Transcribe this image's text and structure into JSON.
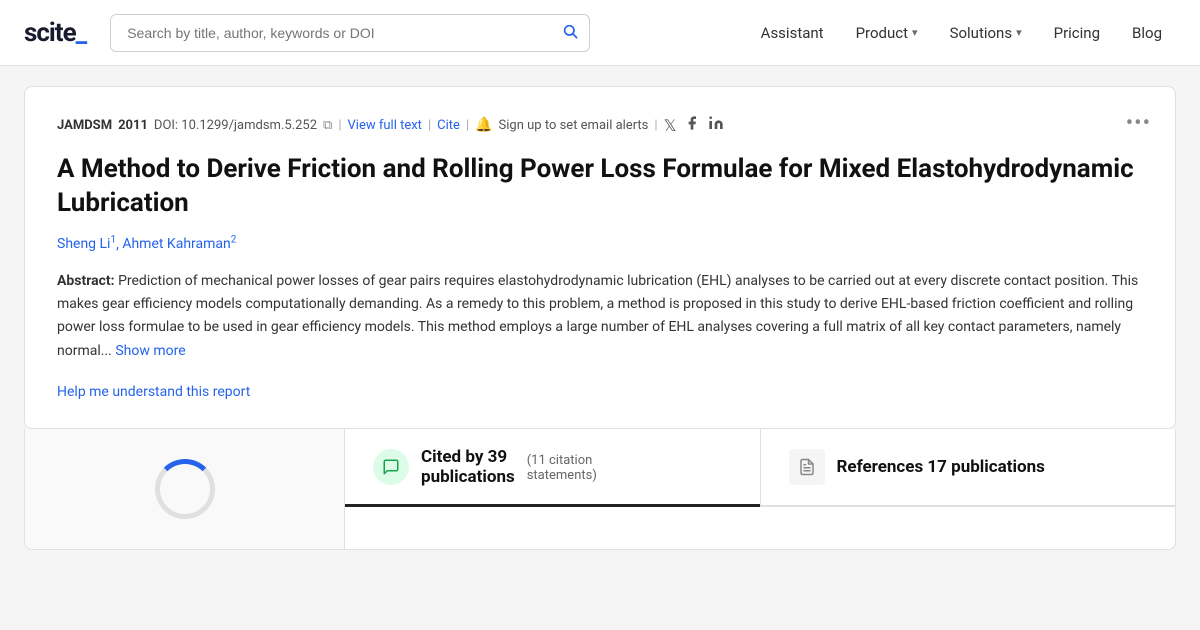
{
  "header": {
    "logo_text": "scite_",
    "search_placeholder": "Search by title, author, keywords or DOI",
    "nav": [
      {
        "label": "Assistant",
        "has_dropdown": false
      },
      {
        "label": "Product",
        "has_dropdown": true
      },
      {
        "label": "Solutions",
        "has_dropdown": true
      },
      {
        "label": "Pricing",
        "has_dropdown": false
      },
      {
        "label": "Blog",
        "has_dropdown": false
      }
    ]
  },
  "paper": {
    "journal": "JAMDSM",
    "year": "2011",
    "doi": "DOI: 10.1299/jamdsm.5.252",
    "view_full_text": "View full text",
    "cite": "Cite",
    "alert_label": "Sign up to set email alerts",
    "title": "A Method to Derive Friction and Rolling Power Loss Formulae for Mixed Elastohydrodynamic Lubrication",
    "authors": [
      {
        "name": "Sheng Li",
        "sup": "1"
      },
      {
        "name": "Ahmet Kahraman",
        "sup": "2"
      }
    ],
    "abstract_label": "Abstract:",
    "abstract_text": "Prediction of mechanical power losses of gear pairs requires elastohydrodynamic lubrication (EHL) analyses to be carried out at every discrete contact position. This makes gear efficiency models computationally demanding. As a remedy to this problem, a method is proposed in this study to derive EHL-based friction coefficient and rolling power loss formulae to be used in gear efficiency models. This method employs a large number of EHL analyses covering a full matrix of all key contact parameters, namely normal...",
    "show_more": "Show more",
    "help_link": "Help me understand this report",
    "more_icon": "•••"
  },
  "citations": {
    "cited_by_count": "39",
    "cited_by_label": "Cited by 39\npublications",
    "cited_by_line1": "Cited by 39",
    "cited_by_line2": "publications",
    "citation_statements_count": "11",
    "citation_statements_label": "(11 citation\nstatements)",
    "citation_statements_line1": "(11 citation",
    "citation_statements_line2": "statements)",
    "references_count": "17",
    "references_label": "References 17 publications"
  }
}
